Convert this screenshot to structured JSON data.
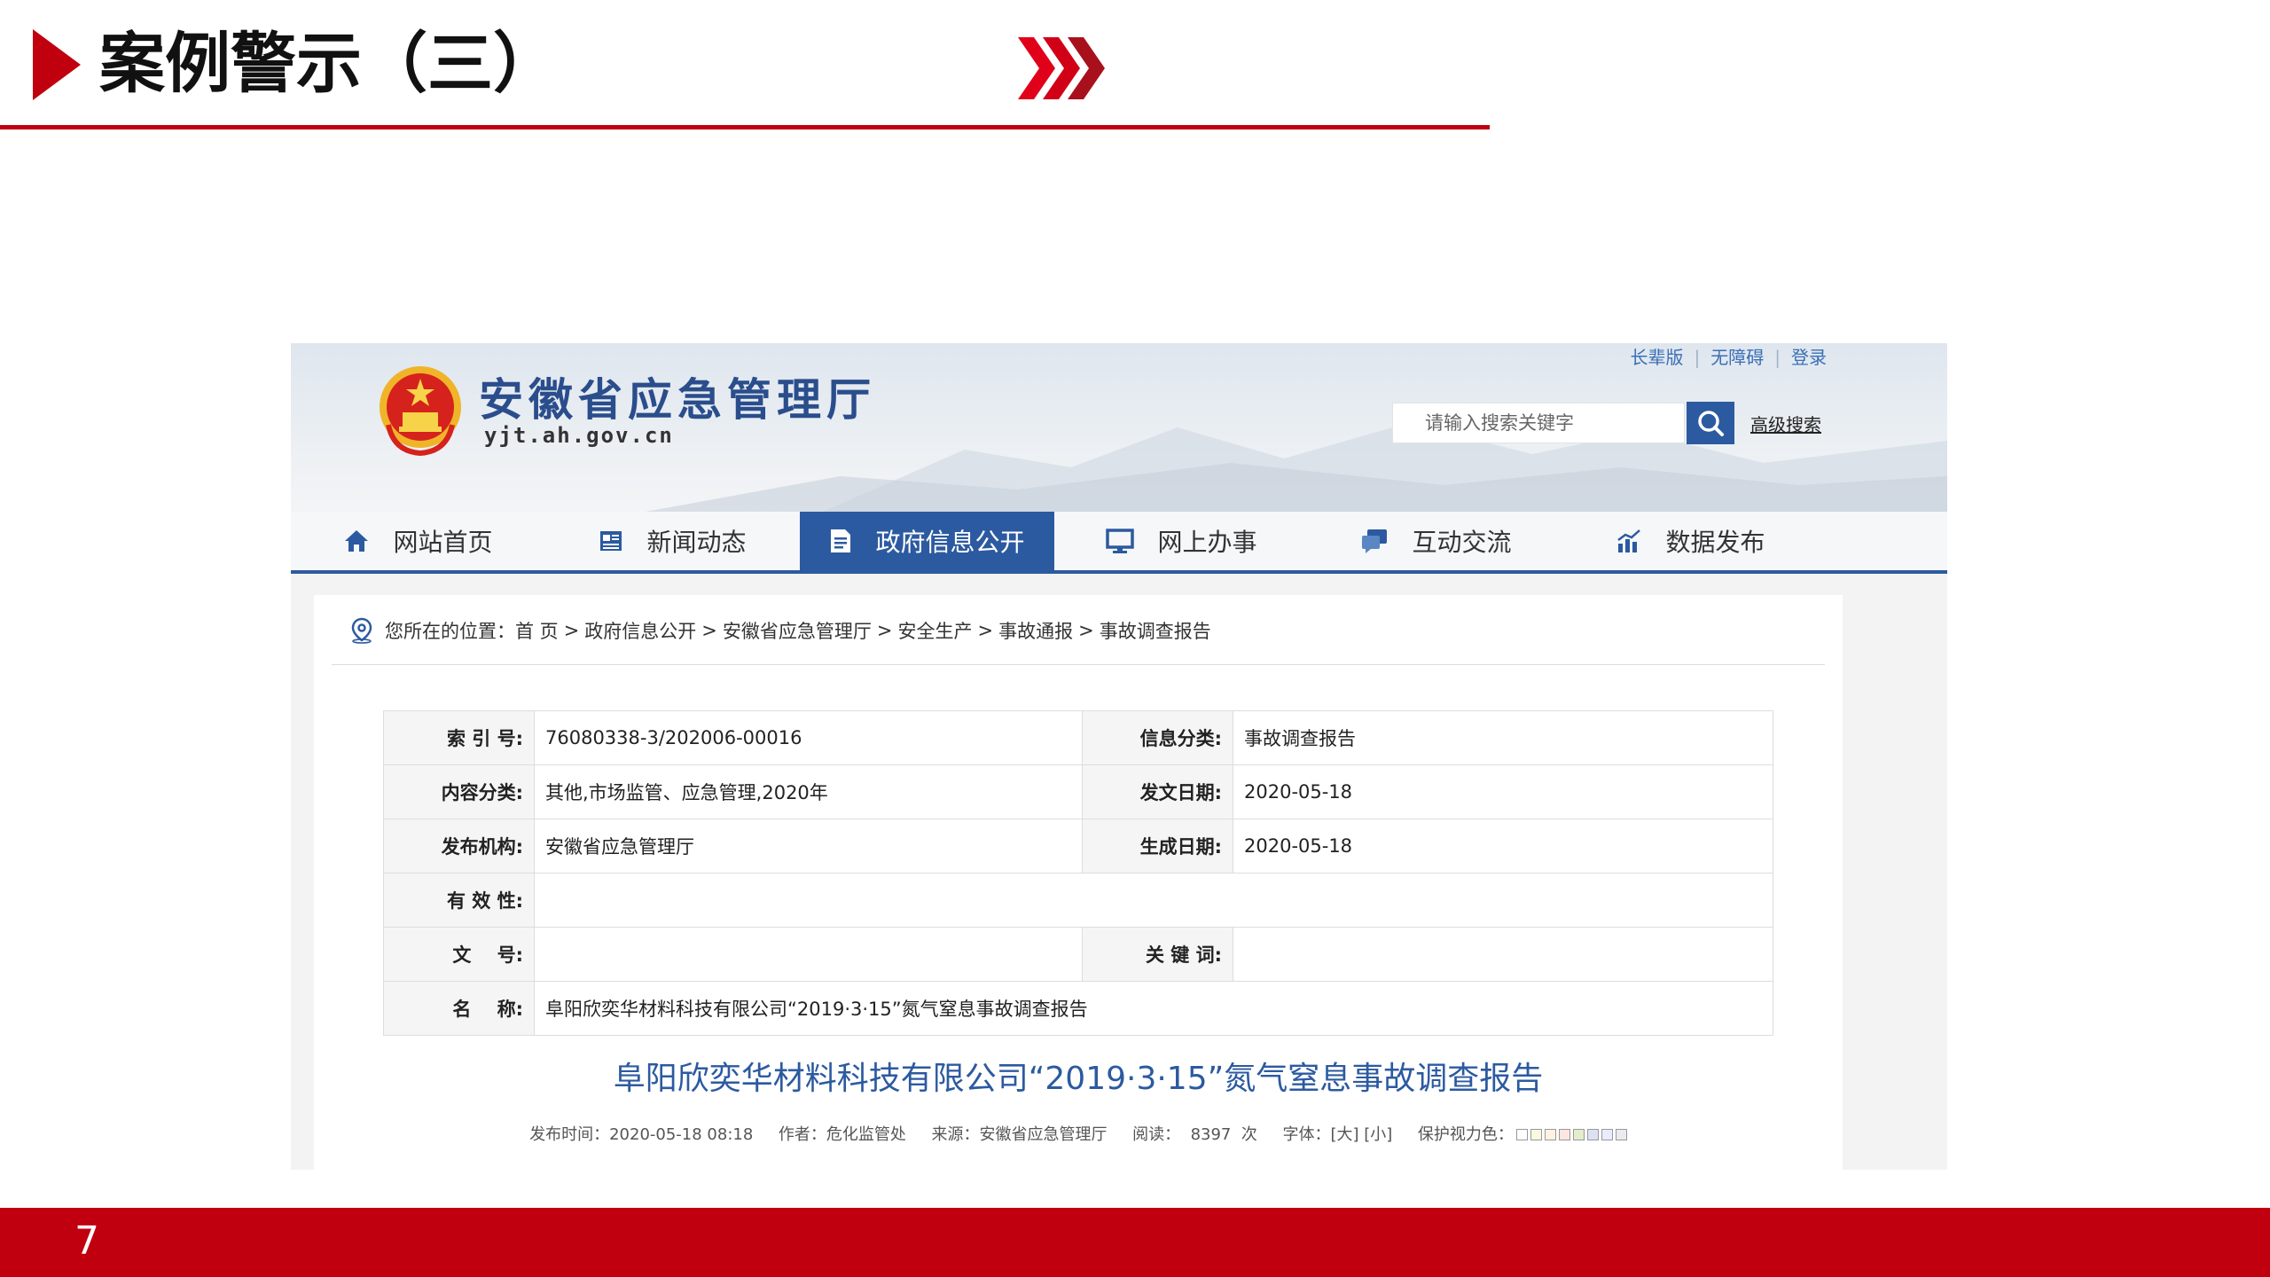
{
  "slide": {
    "title": "案例警示（三）",
    "page_number": "7",
    "accent_color": "#c0000e"
  },
  "site": {
    "name": "安徽省应急管理厅",
    "url": "yjt.ah.gov.cn",
    "emblem_icon": "national-emblem-icon",
    "top_links": [
      "长辈版",
      "无障碍",
      "登录"
    ],
    "search": {
      "placeholder": "请输入搜索关键字",
      "advanced_label": "高级搜索"
    },
    "primary_color": "#2c5aa0",
    "nav": [
      {
        "label": "网站首页",
        "icon": "home-icon",
        "active": false
      },
      {
        "label": "新闻动态",
        "icon": "news-icon",
        "active": false
      },
      {
        "label": "政府信息公开",
        "icon": "document-icon",
        "active": true
      },
      {
        "label": "网上办事",
        "icon": "monitor-icon",
        "active": false
      },
      {
        "label": "互动交流",
        "icon": "chat-icon",
        "active": false
      },
      {
        "label": "数据发布",
        "icon": "chart-icon",
        "active": false
      }
    ]
  },
  "breadcrumb": {
    "prefix": "您所在的位置：",
    "items": [
      "首 页",
      "政府信息公开",
      "安徽省应急管理厅",
      "安全生产",
      "事故通报",
      "事故调查报告"
    ],
    "separator": ">"
  },
  "meta": {
    "index_label": "索 引 号:",
    "index_value": "76080338-3/202006-00016",
    "info_class_label": "信息分类:",
    "info_class_value": "事故调查报告",
    "content_class_label": "内容分类:",
    "content_class_value": "其他,市场监管、应急管理,2020年",
    "issue_date_label": "发文日期:",
    "issue_date_value": "2020-05-18",
    "publisher_label": "发布机构:",
    "publisher_value": "安徽省应急管理厅",
    "created_date_label": "生成日期:",
    "created_date_value": "2020-05-18",
    "validity_label": "有 效 性:",
    "validity_value": "",
    "doc_no_label": "文    号:",
    "doc_no_value": "",
    "keywords_label": "关 键 词:",
    "keywords_value": "",
    "name_label": "名    称:",
    "name_value": "阜阳欣奕华材料科技有限公司“2019·3·15”氮气窒息事故调查报告"
  },
  "article": {
    "title": "阜阳欣奕华材料科技有限公司“2019·3·15”氮气窒息事故调查报告",
    "publish_time_label": "发布时间：",
    "publish_time": "2020-05-18 08:18",
    "author_label": "作者：",
    "author": "危化监管处",
    "source_label": "来源：",
    "source": "安徽省应急管理厅",
    "views_label": "阅读：",
    "views": "8397",
    "views_unit": "次",
    "font_label": "字体：",
    "font_large": "[大]",
    "font_small": "[小]",
    "eye_care_label": "保护视力色：",
    "eye_care_colors": [
      "#ffffff",
      "#faf9de",
      "#fff2e2",
      "#fde6e0",
      "#e3edcd",
      "#dce2f1",
      "#e9ebfe",
      "#eaeaef"
    ]
  }
}
